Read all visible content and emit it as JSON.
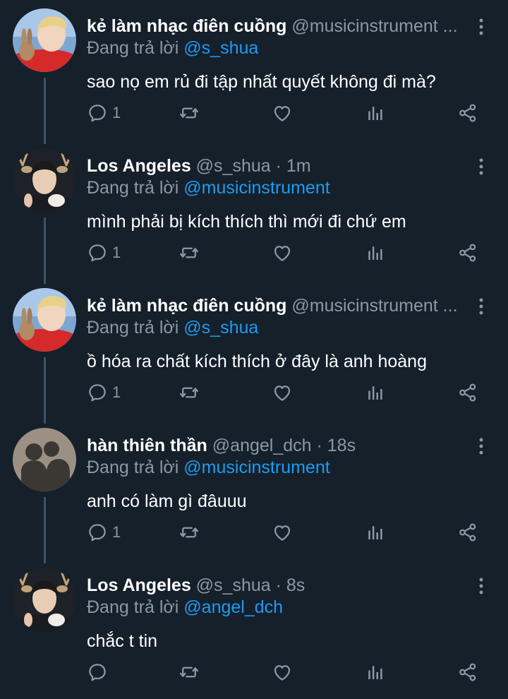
{
  "theme": {
    "background": "#15202b",
    "accent": "#1d9bf0",
    "muted": "#8b98a5",
    "thread_line": "#3d5466"
  },
  "tweets": [
    {
      "name": "kẻ làm nhạc điên cuồng",
      "handle": "@musicinstrument ...",
      "reply_prefix": "Đang trả lời",
      "reply_to": "@s_shua",
      "text": "sao nọ em rủ đi tập nhất quyết không đi mà?",
      "reply_count": "1",
      "avatar": "bunny-avatar-icon"
    },
    {
      "name": "Los Angeles",
      "handle": "@s_shua · 1m",
      "reply_prefix": "Đang trả lời",
      "reply_to": "@musicinstrument",
      "text": "mình phải bị kích thích thì mới đi chứ em",
      "reply_count": "1",
      "avatar": "deer-avatar-icon"
    },
    {
      "name": "kẻ làm nhạc điên cuồng",
      "handle": "@musicinstrument ...",
      "reply_prefix": "Đang trả lời",
      "reply_to": "@s_shua",
      "text": "ồ hóa ra chất kích thích ở đây là anh hoàng",
      "reply_count": "1",
      "avatar": "bunny-avatar-icon"
    },
    {
      "name": "hàn thiên thần",
      "handle": "@angel_dch · 18s",
      "reply_prefix": "Đang trả lời",
      "reply_to": "@musicinstrument",
      "text": "anh có làm gì đâuuu",
      "reply_count": "1",
      "avatar": "shadow-avatar-icon"
    },
    {
      "name": "Los Angeles",
      "handle": "@s_shua · 8s",
      "reply_prefix": "Đang trả lời",
      "reply_to": "@angel_dch",
      "text": "chắc t tin",
      "reply_count": "",
      "avatar": "deer-avatar-icon"
    }
  ]
}
